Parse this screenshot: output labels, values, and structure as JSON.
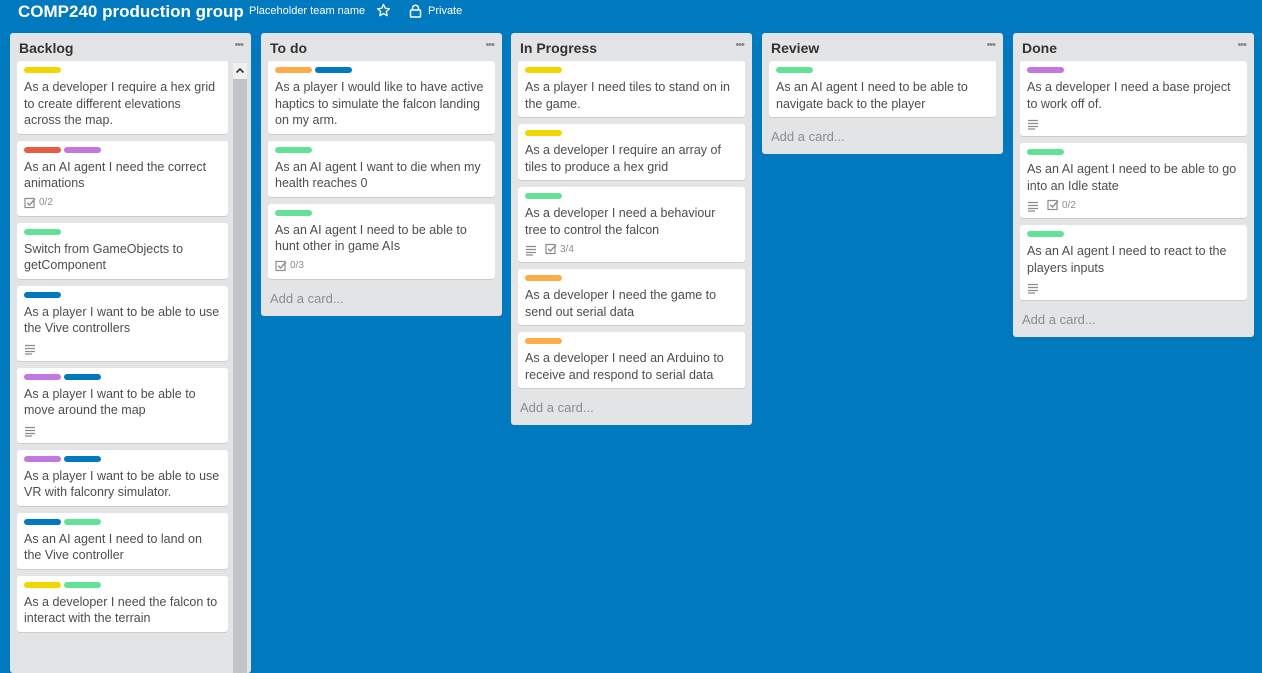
{
  "board": {
    "title": "COMP240 production group",
    "team": "Placeholder team name",
    "privacy": "Private"
  },
  "colors": {
    "yellow": "#f2d600",
    "red": "#eb5a46",
    "purple": "#c377e0",
    "green": "#61e294",
    "blue": "#0079bf",
    "orange": "#ffab4a"
  },
  "lists": [
    {
      "title": "Backlog",
      "cards": [
        {
          "labels": [
            "yellow"
          ],
          "title": "As a developer I require a hex grid to create different elevations across the map."
        },
        {
          "labels": [
            "red",
            "purple"
          ],
          "title": "As an AI agent I need the correct animations",
          "checklist": "0/2"
        },
        {
          "labels": [
            "green"
          ],
          "title": "Switch from GameObjects to getComponent"
        },
        {
          "labels": [
            "blue"
          ],
          "title": "As a player I want to be able to use the Vive controllers",
          "description": true
        },
        {
          "labels": [
            "purple",
            "blue"
          ],
          "title": "As a player I want to be able to move around the map",
          "description": true
        },
        {
          "labels": [
            "purple",
            "blue"
          ],
          "title": "As a player I want to be able to use VR with falconry simulator."
        },
        {
          "labels": [
            "blue",
            "green"
          ],
          "title": "As an AI agent I need to land on the Vive controller"
        },
        {
          "labels": [
            "yellow",
            "green"
          ],
          "title": "As a developer I need the falcon to interact with the terrain"
        }
      ]
    },
    {
      "title": "To do",
      "add_card": "Add a card...",
      "cards": [
        {
          "labels": [
            "orange",
            "blue"
          ],
          "title": "As a player I would like to have active haptics to simulate the falcon landing on my arm."
        },
        {
          "labels": [
            "green"
          ],
          "title": "As an AI agent I want to die when my health reaches 0"
        },
        {
          "labels": [
            "green"
          ],
          "title": "As an AI agent I need to be able to hunt other in game AIs",
          "checklist": "0/3"
        }
      ]
    },
    {
      "title": "In Progress",
      "add_card": "Add a card...",
      "cards": [
        {
          "labels": [
            "yellow"
          ],
          "title": "As a player I need tiles to stand on in the game."
        },
        {
          "labels": [
            "yellow"
          ],
          "title": "As a developer I require an array of tiles to produce a hex grid"
        },
        {
          "labels": [
            "green"
          ],
          "title": "As a developer I need a behaviour tree to control the falcon",
          "description": true,
          "checklist": "3/4"
        },
        {
          "labels": [
            "orange"
          ],
          "title": "As a developer I need the game to send out serial data"
        },
        {
          "labels": [
            "orange"
          ],
          "title": "As a developer I need an Arduino to receive and respond to serial data"
        }
      ]
    },
    {
      "title": "Review",
      "add_card": "Add a card...",
      "cards": [
        {
          "labels": [
            "green"
          ],
          "title": "As an AI agent I need to be able to navigate back to the player"
        }
      ]
    },
    {
      "title": "Done",
      "add_card": "Add a card...",
      "cards": [
        {
          "labels": [
            "purple"
          ],
          "title": "As a developer I need a base project to work off of.",
          "description": true
        },
        {
          "labels": [
            "green"
          ],
          "title": "As an AI agent I need to be able to go into an Idle state",
          "description": true,
          "checklist": "0/2"
        },
        {
          "labels": [
            "green"
          ],
          "title": "As an AI agent I need to react to the players inputs",
          "description": true
        }
      ]
    }
  ]
}
